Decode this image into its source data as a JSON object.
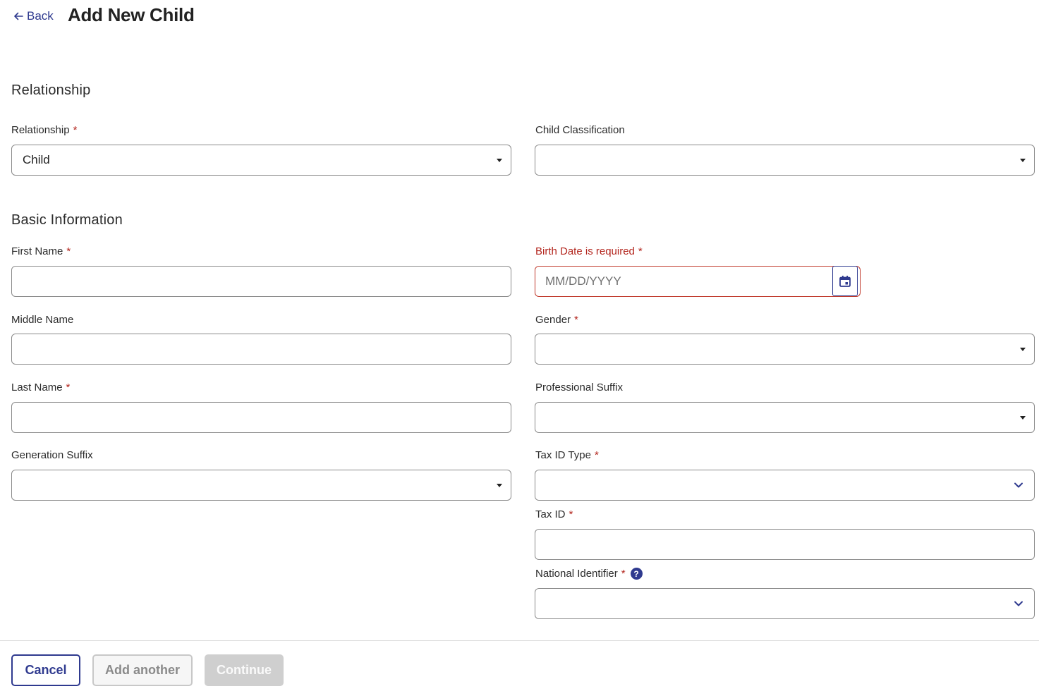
{
  "header": {
    "back_label": "Back",
    "title": "Add New Child"
  },
  "sections": {
    "relationship": "Relationship",
    "basic_info": "Basic Information"
  },
  "fields": {
    "relationship": {
      "label": "Relationship",
      "value": "Child",
      "required": true
    },
    "child_classification": {
      "label": "Child Classification",
      "value": ""
    },
    "first_name": {
      "label": "First Name",
      "value": ""
    },
    "birth_date": {
      "label": "Birth Date is required",
      "placeholder": "MM/DD/YYYY",
      "value": ""
    },
    "middle_name": {
      "label": "Middle Name",
      "value": ""
    },
    "gender": {
      "label": "Gender",
      "value": ""
    },
    "last_name": {
      "label": "Last Name",
      "value": ""
    },
    "professional_suffix": {
      "label": "Professional Suffix",
      "value": ""
    },
    "generation_suffix": {
      "label": "Generation Suffix",
      "value": ""
    },
    "tax_id_type": {
      "label": "Tax ID Type",
      "value": ""
    },
    "tax_id": {
      "label": "Tax ID",
      "value": ""
    },
    "national_identifier": {
      "label": "National Identifier",
      "value": "",
      "help": "?"
    }
  },
  "required_marker": "*",
  "icons": {
    "back": "arrow-left-icon",
    "calendar": "calendar-icon",
    "caret": "caret-down-icon",
    "chevron": "chevron-down-icon",
    "help": "help-icon"
  },
  "buttons": {
    "cancel": "Cancel",
    "add_another": "Add another",
    "continue": "Continue"
  },
  "colors": {
    "accent": "#2f3a8f",
    "error": "#b3261e",
    "border": "#8a8a8a",
    "disabled": "#cfcfcf"
  }
}
